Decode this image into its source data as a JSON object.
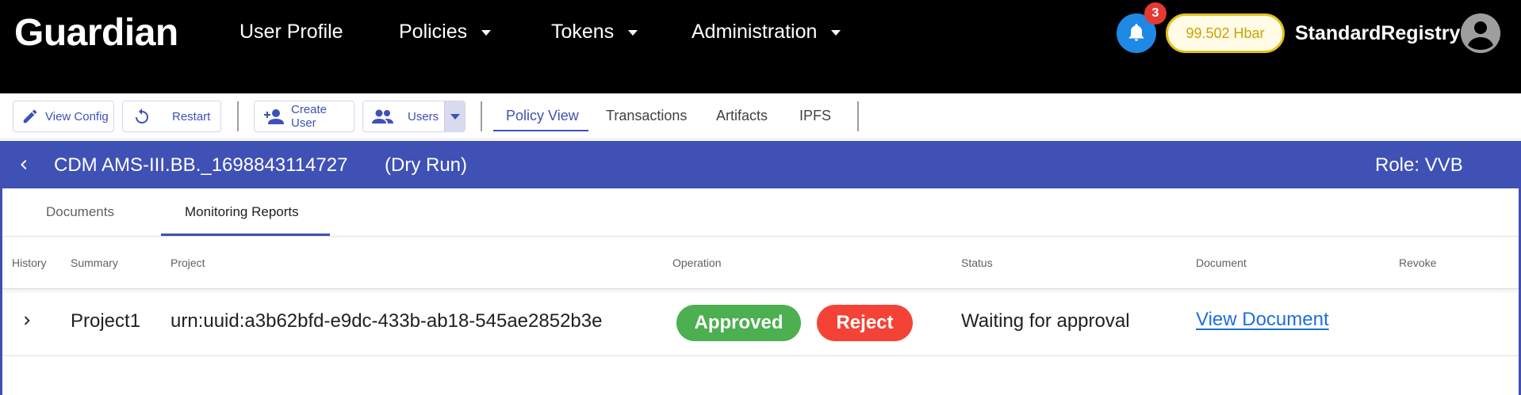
{
  "header": {
    "brand": "Guardian",
    "nav": [
      {
        "label": "User Profile",
        "has_caret": false
      },
      {
        "label": "Policies",
        "has_caret": true
      },
      {
        "label": "Tokens",
        "has_caret": true
      },
      {
        "label": "Administration",
        "has_caret": true
      }
    ],
    "notifications_count": "3",
    "balance": "99.502 Hbar",
    "username": "StandardRegistry",
    "icons": {
      "notifications": "bell-icon",
      "avatar": "account-circle-icon"
    }
  },
  "toolbar": {
    "view_config": "View Config",
    "restart": "Restart",
    "create_user": "Create User",
    "users": "Users",
    "tabs": [
      "Policy View",
      "Transactions",
      "Artifacts",
      "IPFS"
    ],
    "active_tab": "Policy View",
    "icons": {
      "view_config": "pencil-icon",
      "restart": "restart-icon",
      "create_user": "person-add-icon",
      "users": "people-icon",
      "users_dropdown": "caret-down-icon"
    }
  },
  "policy": {
    "name": "CDM AMS-III.BB._1698843114727",
    "mode": "(Dry Run)",
    "role": "Role: VVB",
    "icons": {
      "back": "chevron-left-icon"
    }
  },
  "subtabs": {
    "items": [
      "Documents",
      "Monitoring Reports"
    ],
    "active": "Monitoring Reports"
  },
  "table": {
    "columns": [
      "History",
      "Summary",
      "Project",
      "Operation",
      "Status",
      "Document",
      "Revoke"
    ],
    "rows": [
      {
        "summary": "Project1",
        "project": "urn:uuid:a3b62bfd-e9dc-433b-ab18-545ae2852b3e",
        "approve_label": "Approved",
        "reject_label": "Reject",
        "status": "Waiting for approval",
        "document_link": "View Document",
        "revoke": ""
      }
    ],
    "colors": {
      "approve": "#4caf50",
      "reject": "#f44336",
      "link": "#1e6fd9"
    }
  },
  "colors": {
    "accent": "#3f51b5",
    "topbar": "#000000",
    "balance_border": "#e1c21a"
  }
}
